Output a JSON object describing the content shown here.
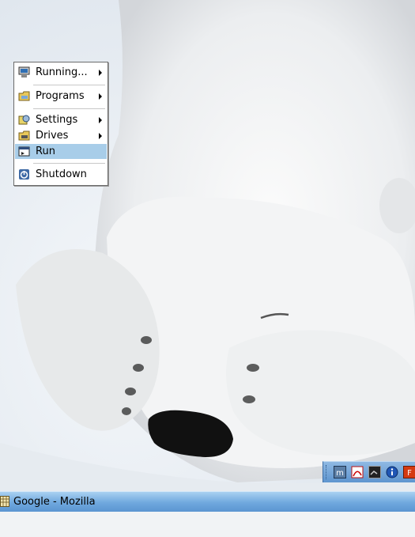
{
  "start_menu": {
    "items": [
      {
        "label": "Running...",
        "icon": "monitor-icon",
        "submenu": true
      },
      {
        "label": "Programs",
        "icon": "folder-icon",
        "submenu": true
      },
      {
        "label": "Settings",
        "icon": "settings-icon",
        "submenu": true
      },
      {
        "label": "Drives",
        "icon": "drive-icon",
        "submenu": true
      },
      {
        "label": "Run",
        "icon": "run-icon",
        "submenu": false,
        "active": true
      },
      {
        "label": "Shutdown",
        "icon": "shutdown-icon",
        "submenu": false
      }
    ],
    "highlight_color": "#a8cde9"
  },
  "tray": {
    "icons": [
      "mozilla-icon",
      "acrobat-icon",
      "terminal-icon",
      "info-icon",
      "app-icon"
    ]
  },
  "taskbar": {
    "task_label": "Google - Mozilla",
    "color": "#6fa8de"
  }
}
